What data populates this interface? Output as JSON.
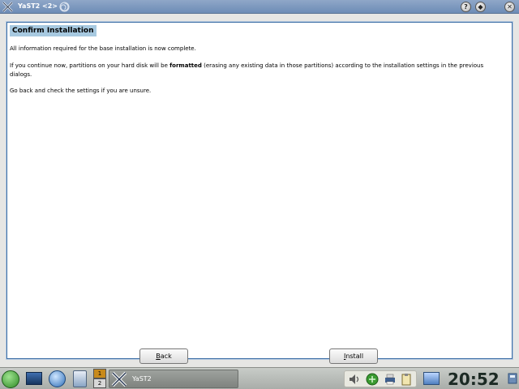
{
  "window": {
    "title": "YaST2 <2>",
    "buttons": {
      "help": "?",
      "menu": "◆",
      "close": "✕"
    }
  },
  "dialog": {
    "heading": "Confirm Installation",
    "para1": "All information required for the base installation is now complete.",
    "para2_pre": "If you continue now, partitions on your hard disk will be ",
    "para2_bold": "formatted",
    "para2_post": " (erasing any existing data in those partitions) according to the installation settings in the previous dialogs.",
    "para3": "Go back and check the settings if you are unsure.",
    "back_label_accel": "B",
    "back_label_rest": "ack",
    "install_label_accel": "I",
    "install_label_rest": "nstall"
  },
  "taskbar": {
    "pager": [
      "1",
      "2"
    ],
    "task_label": "YaST2",
    "clock": "20:52"
  },
  "colors": {
    "titlebar": "#7f99bf",
    "accent": "#3e6fa6",
    "heading_bg": "#a7c9e0"
  },
  "icons": [
    "yast-icon",
    "swirl-icon",
    "help-icon",
    "menu-icon",
    "close-icon",
    "kmenu-icon",
    "desktop-icon",
    "globe-icon",
    "file-manager-icon",
    "volume-icon",
    "network-icon",
    "printer-icon",
    "clipboard-icon",
    "monitor-icon",
    "system-icon"
  ]
}
